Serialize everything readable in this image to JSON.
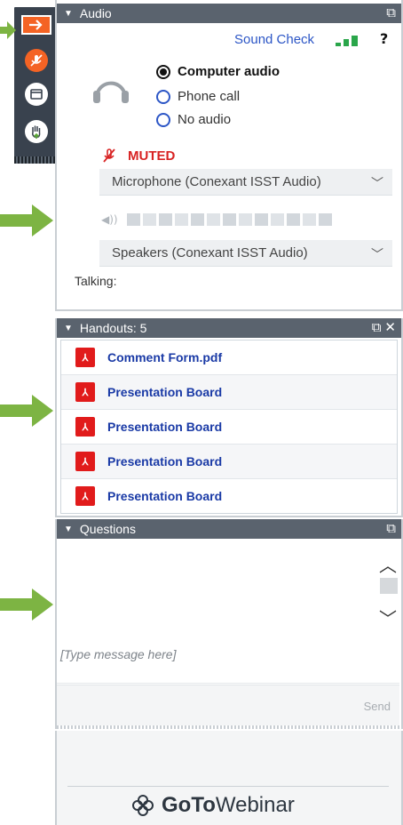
{
  "toolbar": {
    "buttons": [
      {
        "name": "arrow-right-icon"
      },
      {
        "name": "mic-muted-icon"
      },
      {
        "name": "window-icon"
      },
      {
        "name": "raise-hand-icon"
      }
    ]
  },
  "colors": {
    "toolbar_bg": "#39424e",
    "header_bg": "#5a636e",
    "accent_orange": "#f46324",
    "link_blue": "#2c56c6",
    "muted_red": "#d82323",
    "arrow_green": "#7db443"
  },
  "audio": {
    "title": "Audio",
    "sound_check": "Sound Check",
    "help": "?",
    "options": [
      {
        "label": "Computer audio",
        "selected": true
      },
      {
        "label": "Phone call",
        "selected": false
      },
      {
        "label": "No audio",
        "selected": false
      }
    ],
    "muted_label": "MUTED",
    "microphone": "Microphone (Conexant ISST Audio)",
    "speakers": "Speakers (Conexant ISST Audio)",
    "talking_label": "Talking:"
  },
  "handouts": {
    "title": "Handouts: 5",
    "items": [
      "Comment Form.pdf",
      "Presentation Board",
      "Presentation Board",
      "Presentation Board",
      "Presentation Board"
    ]
  },
  "questions": {
    "title": "Questions",
    "placeholder": "[Type message here]",
    "send_label": "Send"
  },
  "footer": {
    "brand_bold": "GoTo",
    "brand_rest": "Webinar"
  }
}
